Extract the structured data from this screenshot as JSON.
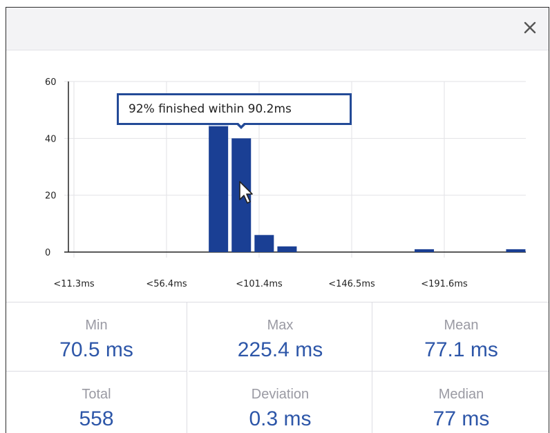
{
  "header": {
    "close_icon": "close-icon"
  },
  "chart_data": {
    "type": "bar",
    "title": "",
    "xlabel": "",
    "ylabel": "",
    "ylim": [
      0,
      60
    ],
    "y_ticks": [
      "0",
      "20",
      "40",
      "60"
    ],
    "x_tick_labels": [
      "<11.3ms",
      "<56.4ms",
      "<101.4ms",
      "<146.5ms",
      "<191.6ms"
    ],
    "bar_color": "#1a3f94",
    "highlight_color": "#c8d4ec",
    "bins": 20,
    "bin_values": [
      0,
      0,
      0,
      0,
      0,
      0,
      52,
      40,
      6,
      2,
      0,
      0,
      0,
      0,
      0,
      1,
      0,
      0,
      0,
      1
    ],
    "highlighted_bin": 6,
    "hovered_bin": 7,
    "grid": true
  },
  "tooltip": {
    "text": "92% finished within 90.2ms"
  },
  "stats": [
    {
      "key": "min",
      "label": "Min",
      "value": "70.5 ms"
    },
    {
      "key": "max",
      "label": "Max",
      "value": "225.4 ms"
    },
    {
      "key": "mean",
      "label": "Mean",
      "value": "77.1 ms"
    },
    {
      "key": "total",
      "label": "Total",
      "value": "558"
    },
    {
      "key": "deviation",
      "label": "Deviation",
      "value": "0.3 ms"
    },
    {
      "key": "median",
      "label": "Median",
      "value": "77 ms"
    }
  ]
}
